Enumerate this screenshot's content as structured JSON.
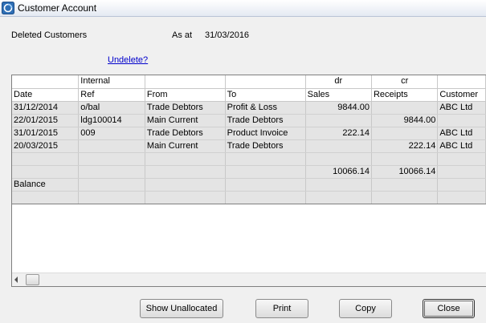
{
  "window": {
    "title": "Customer Account"
  },
  "header": {
    "status": "Deleted Customers",
    "as_at_label": "As at",
    "as_at_date": "31/03/2016",
    "undelete_link": "Undelete?"
  },
  "grid": {
    "group_headers": [
      "",
      "Internal",
      "",
      "",
      "dr",
      "cr",
      ""
    ],
    "columns": [
      "Date",
      "Ref",
      "From",
      "To",
      "Sales",
      "Receipts",
      "Customer"
    ],
    "rows": [
      [
        "31/12/2014",
        "o/bal",
        "Trade Debtors",
        "Profit & Loss",
        "9844.00",
        "",
        "ABC Ltd"
      ],
      [
        "22/01/2015",
        "ldg100014",
        "Main Current",
        "Trade Debtors",
        "",
        "9844.00",
        ""
      ],
      [
        "31/01/2015",
        "009",
        "Trade Debtors",
        "Product Invoice",
        "222.14",
        "",
        "ABC Ltd"
      ],
      [
        "20/03/2015",
        "",
        "Main Current",
        "Trade Debtors",
        "",
        "222.14",
        "ABC Ltd"
      ],
      [
        "",
        "",
        "",
        "",
        "",
        "",
        ""
      ],
      [
        "",
        "",
        "",
        "",
        "10066.14",
        "10066.14",
        ""
      ],
      [
        "Balance",
        "",
        "",
        "",
        "",
        "",
        ""
      ],
      [
        "",
        "",
        "",
        "",
        "",
        "",
        ""
      ]
    ]
  },
  "buttons": {
    "show_unallocated": "Show Unallocated",
    "print": "Print",
    "copy": "Copy",
    "close": "Close"
  }
}
